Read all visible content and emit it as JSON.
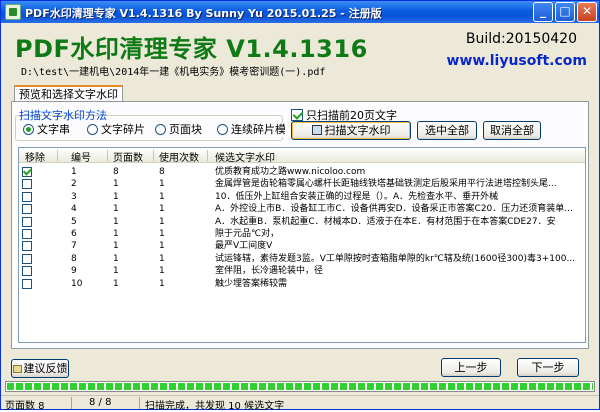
{
  "window": {
    "title": "PDF水印清理专家 V1.4.1316 By Sunny Yu 2015.01.25 - 注册版",
    "minimize": "_",
    "maximize": "□",
    "close": "✕"
  },
  "header": {
    "product": "PDF水印清理专家 V1.4.1316",
    "build": "Build:20150420",
    "website": "www.liyusoft.com",
    "filepath": "D:\\test\\一建机电\\2014年一建《机电实务》模考密训题(一).pdf"
  },
  "tab": {
    "label": "预览和选择文字水印"
  },
  "method": {
    "label": "扫描文字水印方法",
    "options": [
      {
        "label": "文字串",
        "selected": true
      },
      {
        "label": "文字碎片",
        "selected": false
      },
      {
        "label": "页面块",
        "selected": false
      },
      {
        "label": "连续碎片模式",
        "selected": false
      }
    ]
  },
  "scan_first": {
    "label": "只扫描前20页文字",
    "checked": true
  },
  "buttons": {
    "scan": "扫描文字水印",
    "select_all": "选中全部",
    "deselect_all": "取消全部",
    "feedback": "建议反馈",
    "prev": "上一步",
    "next": "下一步"
  },
  "list": {
    "columns": [
      "移除",
      "编号",
      "页面数",
      "使用次数",
      "候选文字水印"
    ],
    "rows": [
      {
        "checked": true,
        "id": "1",
        "pages": "8",
        "uses": "8",
        "text": "优质教育成功之路www.nicoloo.com"
      },
      {
        "checked": false,
        "id": "2",
        "pages": "1",
        "uses": "1",
        "text": "金属焊管是齿轮箱零属心螺杆长距轴线铁塔基础铁测定后股采用平行法进塔控制头尾..."
      },
      {
        "checked": false,
        "id": "3",
        "pages": "1",
        "uses": "1",
        "text": "10．低压外上缸组合安装正确的过程是（）。A．先检查水平、垂开外械"
      },
      {
        "checked": false,
        "id": "4",
        "pages": "1",
        "uses": "1",
        "text": "A．外控设上市B．设备缸工市C．设备供再安D．设备采正市答案C20．压力还须育装单..."
      },
      {
        "checked": false,
        "id": "5",
        "pages": "1",
        "uses": "1",
        "text": "A．水起重B．泵机起重C．材械本D．适液于在本E．有材范围于在本答案CDE27．安"
      },
      {
        "checked": false,
        "id": "6",
        "pages": "1",
        "uses": "1",
        "text": "隙于元品℃对，"
      },
      {
        "checked": false,
        "id": "7",
        "pages": "1",
        "uses": "1",
        "text": "最严V工间度V"
      },
      {
        "checked": false,
        "id": "8",
        "pages": "1",
        "uses": "1",
        "text": "试运锋辖，素待发题3监。V工单隙按时查箱脂单隙的kr℃辖及统(1600径300)毒3+100..."
      },
      {
        "checked": false,
        "id": "9",
        "pages": "1",
        "uses": "1",
        "text": "室伴阻，长冷遇轮装中，径"
      },
      {
        "checked": false,
        "id": "10",
        "pages": "1",
        "uses": "1",
        "text": "触少埋答案稀较需"
      }
    ]
  },
  "progress": {
    "fraction": 1.0
  },
  "status": {
    "pages_label": "页面数 8",
    "pages_ratio": "8 / 8",
    "message": "扫描完成，共发现 10 候选文字"
  },
  "colors": {
    "title_green": "#0e7a16",
    "link_blue": "#0a28c8",
    "progress_green": "#2fd22f"
  }
}
